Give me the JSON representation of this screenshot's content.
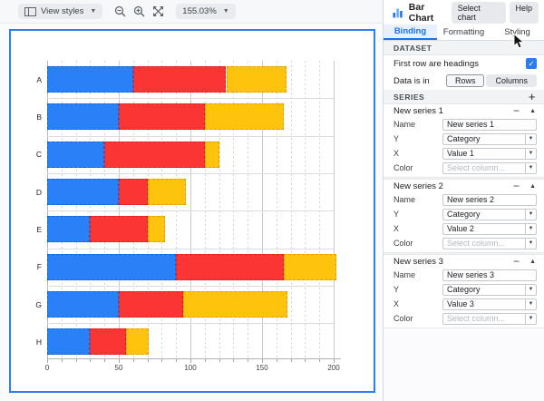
{
  "toolbar": {
    "view_styles_label": "View styles",
    "zoom_level": "155.03%"
  },
  "panel": {
    "title": "Bar Chart",
    "select_chart_label": "Select chart",
    "help_label": "Help",
    "tabs": [
      {
        "label": "Binding"
      },
      {
        "label": "Formatting"
      },
      {
        "label": "Styling"
      }
    ],
    "active_tab": "Binding",
    "dataset": {
      "section_label": "DATASET",
      "first_row_label": "First row are headings",
      "first_row_checked": true,
      "check_glyph": "✓",
      "data_is_in_label": "Data is in",
      "rows_label": "Rows",
      "columns_label": "Columns",
      "selected_orientation": "Rows"
    },
    "series_section_label": "SERIES",
    "add_series_glyph": "+",
    "series": [
      {
        "header": "New series 1",
        "name_label": "Name",
        "name_value": "New series 1",
        "y_label": "Y",
        "y_value": "Category",
        "x_label": "X",
        "x_value": "Value 1",
        "color_label": "Color",
        "color_placeholder": "Select column..."
      },
      {
        "header": "New series 2",
        "name_label": "Name",
        "name_value": "New series 2",
        "y_label": "Y",
        "y_value": "Category",
        "x_label": "X",
        "x_value": "Value 2",
        "color_label": "Color",
        "color_placeholder": "Select column..."
      },
      {
        "header": "New series 3",
        "name_label": "Name",
        "name_value": "New series 3",
        "y_label": "Y",
        "y_value": "Category",
        "x_label": "X",
        "x_value": "Value 3",
        "color_label": "Color",
        "color_placeholder": "Select column..."
      }
    ]
  },
  "chart_data": {
    "type": "bar",
    "orientation": "horizontal",
    "stacked": true,
    "title": "",
    "xlabel": "",
    "ylabel": "",
    "categories": [
      "A",
      "B",
      "C",
      "D",
      "E",
      "F",
      "G",
      "H"
    ],
    "series": [
      {
        "name": "Value 1",
        "color": "#2a80f6",
        "values": [
          60,
          50,
          40,
          50,
          30,
          90,
          50,
          30
        ]
      },
      {
        "name": "Value 2",
        "color": "#fb3434",
        "values": [
          65,
          60,
          70,
          20,
          40,
          75,
          45,
          25
        ]
      },
      {
        "name": "Value 3",
        "color": "#fdc30d",
        "values": [
          42,
          55,
          10,
          27,
          12,
          37,
          73,
          16
        ]
      }
    ],
    "xticks": [
      0,
      50,
      100,
      150,
      200
    ],
    "xlim": [
      0,
      205
    ],
    "grid": true,
    "minor_grid_step": 10,
    "legend_position": "none",
    "accent_border_color": "#2d7ff0"
  }
}
